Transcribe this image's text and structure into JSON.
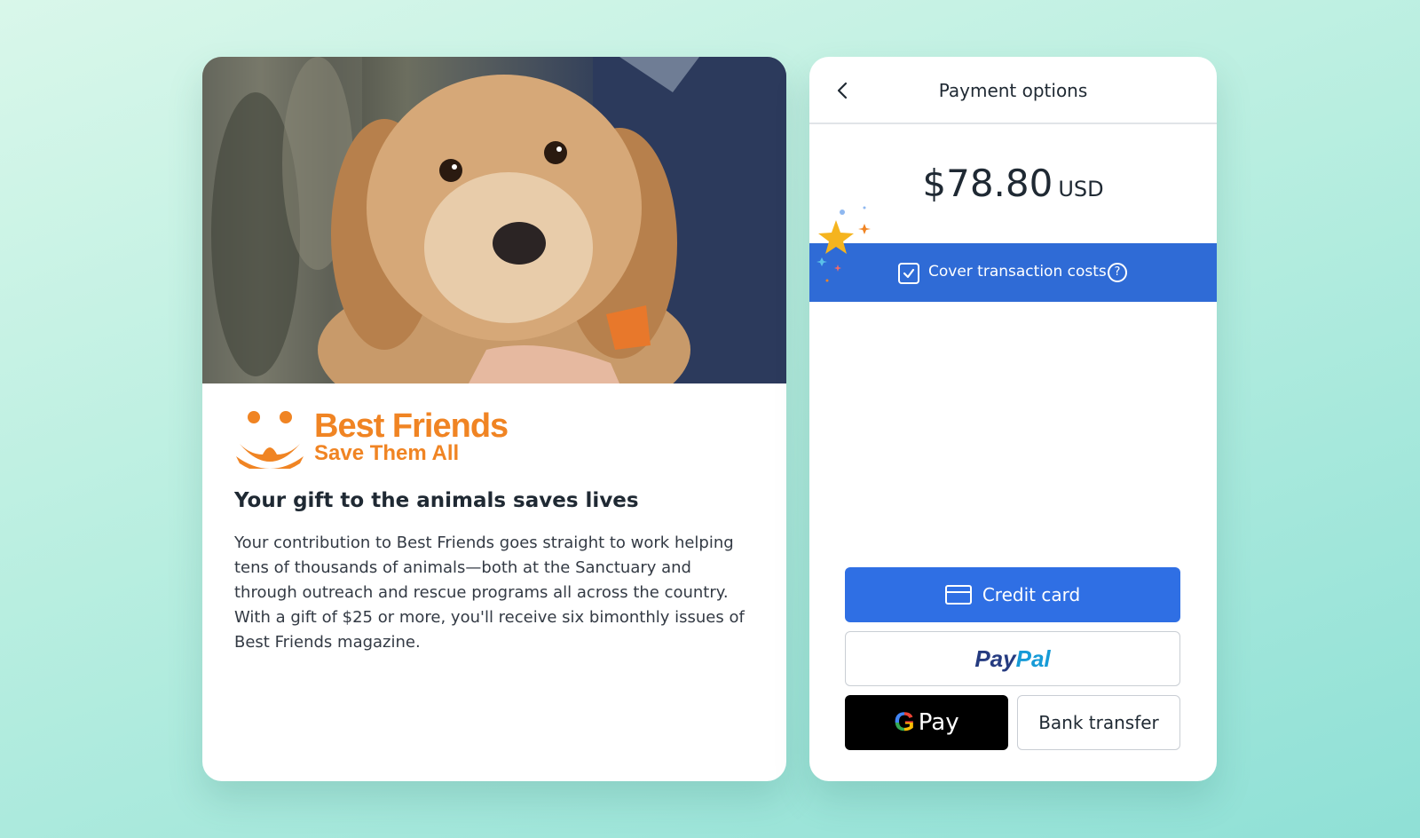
{
  "info": {
    "logo_title": "Best Friends",
    "logo_tagline": "Save Them All",
    "heading": "Your gift to the animals saves lives",
    "body": "Your contribution to Best Friends goes straight to work helping tens of thousands of animals—both at the Sanctuary and through outreach and rescue programs all across the country. With a gift of $25 or more, you'll receive six bimonthly issues of Best Friends magazine."
  },
  "payment": {
    "title": "Payment options",
    "amount": "$78.80",
    "currency": "USD",
    "cover_label": "Cover transaction costs",
    "cover_checked": true,
    "credit_card_label": "Credit card",
    "paypal_p": "Pay",
    "paypal_pal": "Pal",
    "gpay_g": "G",
    "gpay_label": "Pay",
    "bank_label": "Bank transfer"
  },
  "colors": {
    "brand_orange": "#f08423",
    "accent_blue": "#2f6bd6",
    "button_blue": "#2f6fe4"
  },
  "icons": {
    "back": "chevron-left-icon",
    "check": "checkbox-checked-icon",
    "help": "question-circle-icon",
    "card": "credit-card-icon"
  }
}
